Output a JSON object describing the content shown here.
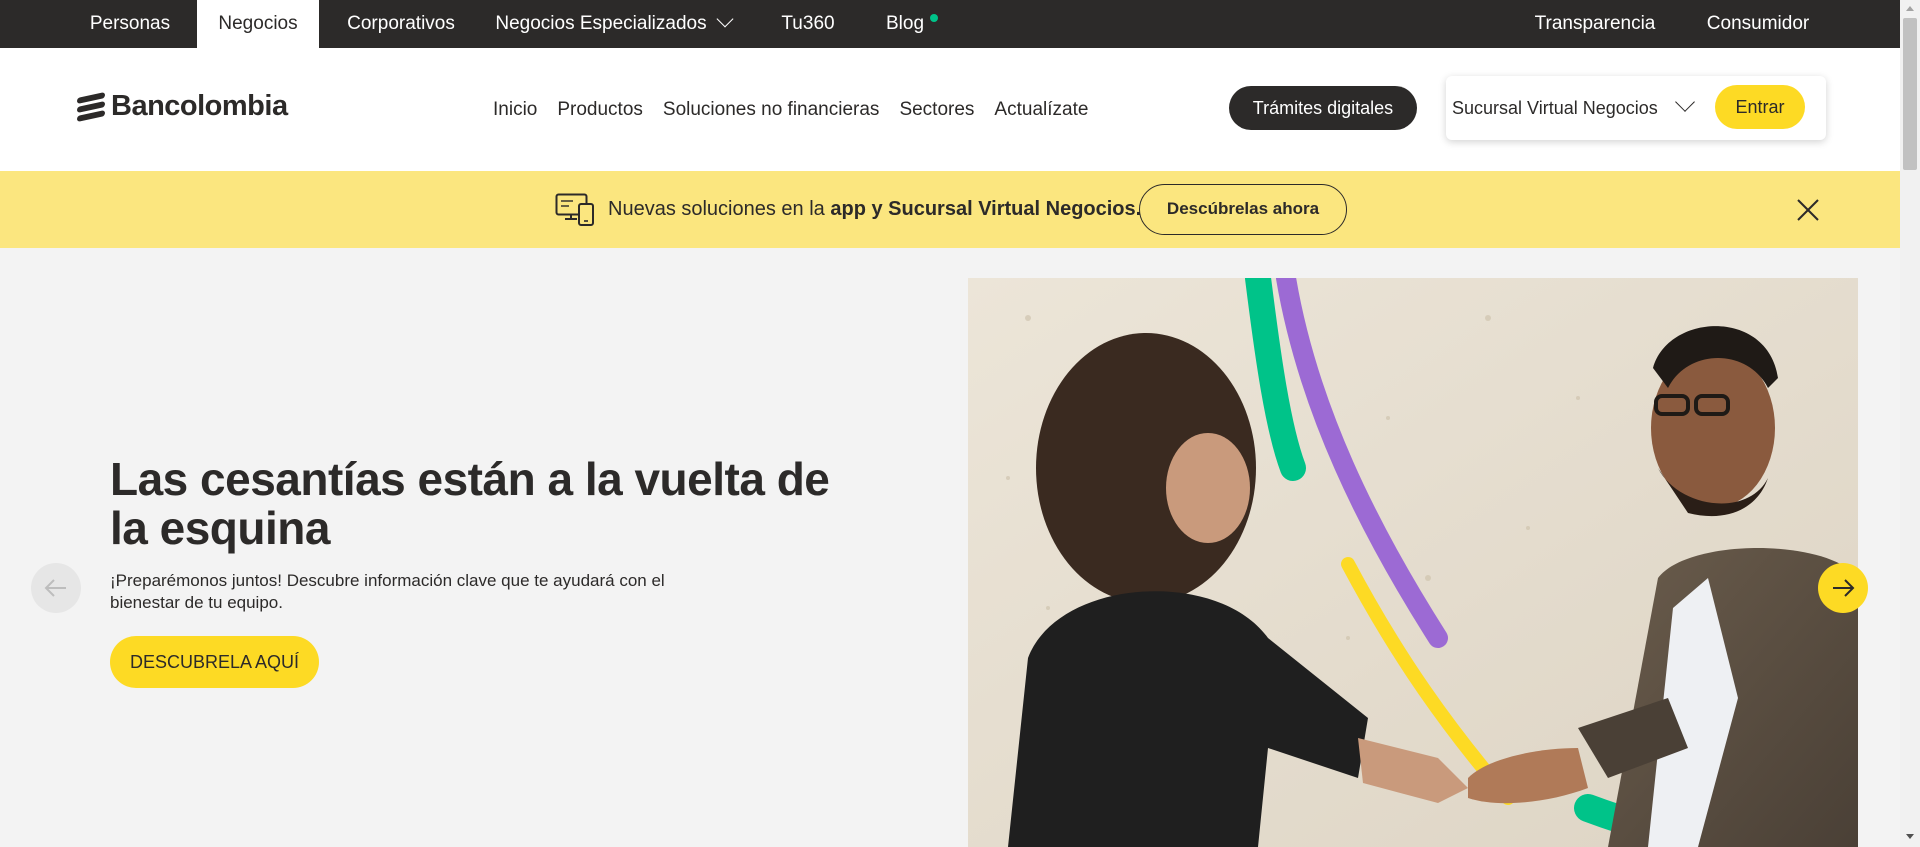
{
  "topbar": {
    "items": [
      {
        "label": "Personas"
      },
      {
        "label": "Negocios",
        "active": true
      },
      {
        "label": "Corporativos"
      },
      {
        "label": "Negocios Especializados",
        "icon": "chevron-down-icon"
      },
      {
        "label": "Tu360"
      },
      {
        "label": "Blog",
        "icon": "notification-dot"
      },
      {
        "label": "Transparencia"
      },
      {
        "label": "Consumidor"
      }
    ]
  },
  "header": {
    "logo_text": "Bancolombia",
    "nav": [
      {
        "label": "Inicio"
      },
      {
        "label": "Productos"
      },
      {
        "label": "Soluciones no financieras"
      },
      {
        "label": "Sectores"
      },
      {
        "label": "Actualízate"
      }
    ],
    "tramites_label": "Trámites digitales",
    "sucursal_label": "Sucursal Virtual Negocios",
    "entrar_label": "Entrar"
  },
  "banner": {
    "text_light": "Nuevas soluciones en la ",
    "text_bold": "app y Sucursal Virtual Negocios.",
    "button_label": "Descúbrelas ahora",
    "icon": "devices-icon"
  },
  "hero": {
    "title": "Las cesantías están a la vuelta de la esquina",
    "subtitle": "¡Preparémonos juntos! Descubre información clave que te ayudará con el bienestar de tu equipo.",
    "cta_label": "DESCUBRELA AQUÍ",
    "image_alt": "handshake-photo"
  },
  "colors": {
    "dark": "#2c2a29",
    "brand_yellow": "#fdda24",
    "banner_yellow": "#fbe67f",
    "accent_green": "#00c389",
    "accent_purple": "#9c6ad4"
  }
}
